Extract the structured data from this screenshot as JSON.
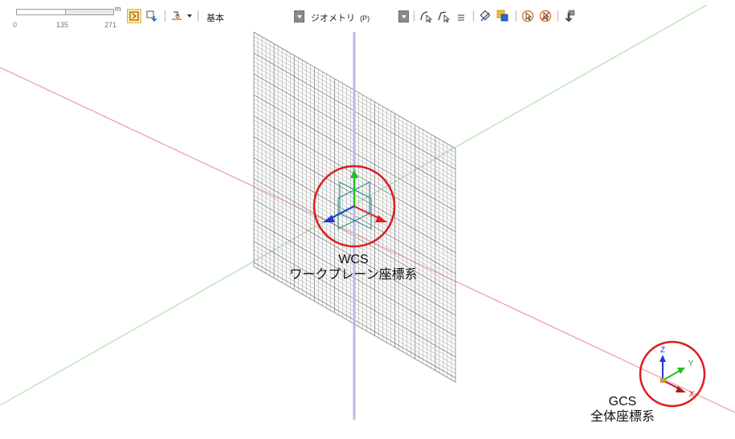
{
  "scalebar": {
    "unit": "m",
    "ticks": [
      "0",
      "135",
      "271"
    ]
  },
  "toolbar": {
    "mode_label": "基本",
    "geometry_label": "ジオメトリ",
    "geometry_hotkey": "(P)"
  },
  "wcs": {
    "abbr": "WCS",
    "name": "ワークプレーン座標系"
  },
  "gcs": {
    "abbr": "GCS",
    "name": "全体座標系",
    "axis_x": "X",
    "axis_y": "Y",
    "axis_z": "Z"
  },
  "colors": {
    "axis_x": "#e88a8a",
    "axis_y": "#9bdc9b",
    "axis_z": "#a9a9e0",
    "highlight_circle": "#dd1c1c",
    "grid": "#8f8f8f",
    "arrow_x": "#e02020",
    "arrow_y": "#22c022",
    "arrow_z": "#1a3ad0",
    "wcs_plane": "#2a8c8c"
  }
}
